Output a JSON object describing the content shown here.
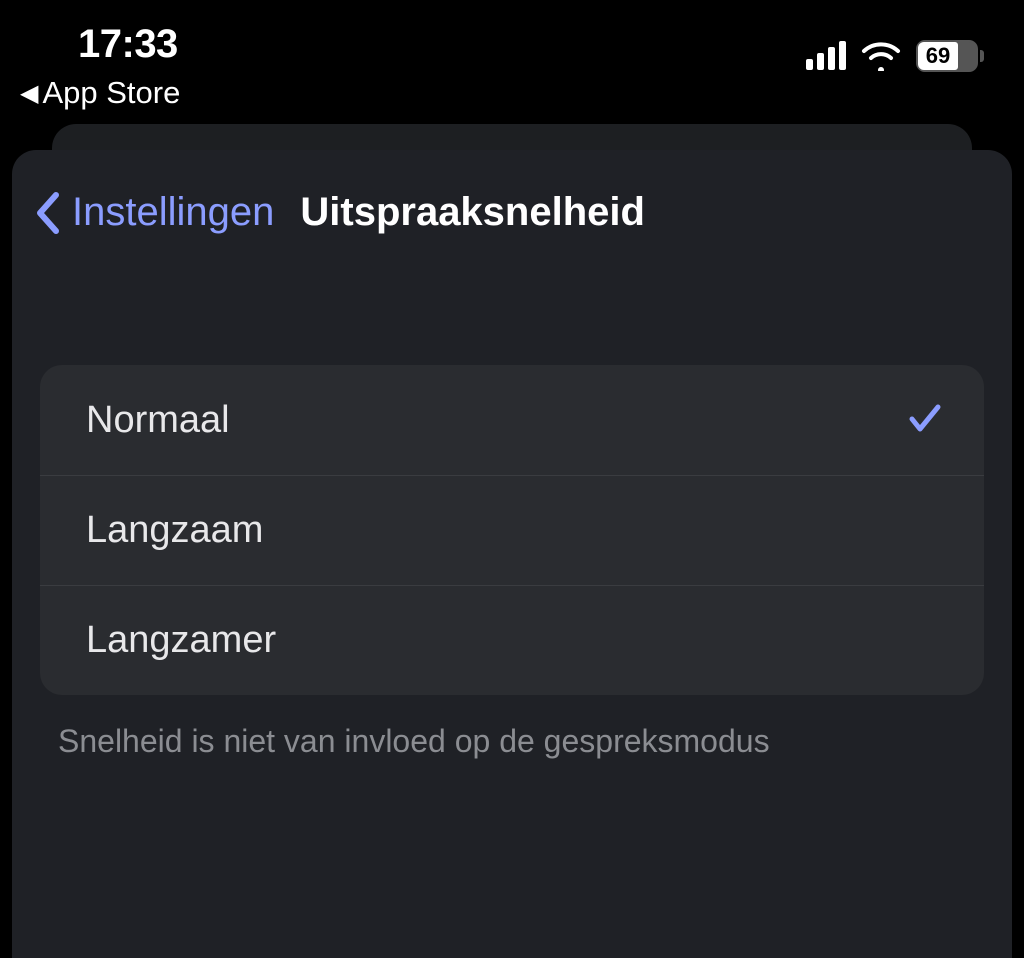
{
  "status": {
    "time": "17:33",
    "back_app": "App Store",
    "battery_pct": "69"
  },
  "nav": {
    "back_label": "Instellingen",
    "title": "Uitspraaksnelheid"
  },
  "options": [
    {
      "label": "Normaal",
      "selected": true
    },
    {
      "label": "Langzaam",
      "selected": false
    },
    {
      "label": "Langzamer",
      "selected": false
    }
  ],
  "footer": "Snelheid is niet van invloed op de gespreksmodus"
}
